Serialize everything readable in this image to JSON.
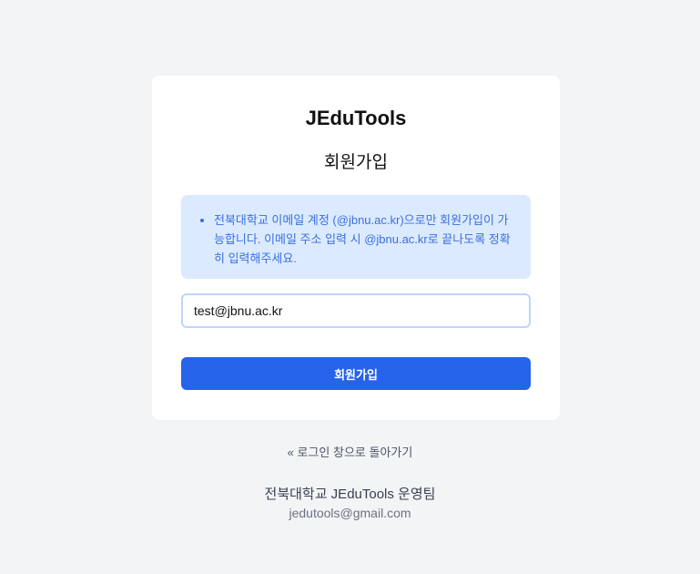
{
  "brand": "JEduTools",
  "title": "회원가입",
  "notice": "전북대학교 이메일 계정 (@jbnu.ac.kr)으로만 회원가입이 가능합니다. 이메일 주소 입력 시 @jbnu.ac.kr로 끝나도록 정확히 입력해주세요.",
  "email_input": {
    "value": "test@jbnu.ac.kr"
  },
  "submit_label": "회원가입",
  "back_link": "« 로그인 창으로 돌아가기",
  "footer": {
    "team": "전북대학교 JEduTools 운영팀",
    "email": "jedutools@gmail.com"
  },
  "colors": {
    "accent": "#2563eb",
    "notice_bg": "#dbeafe",
    "notice_text": "#3b6fe0"
  }
}
